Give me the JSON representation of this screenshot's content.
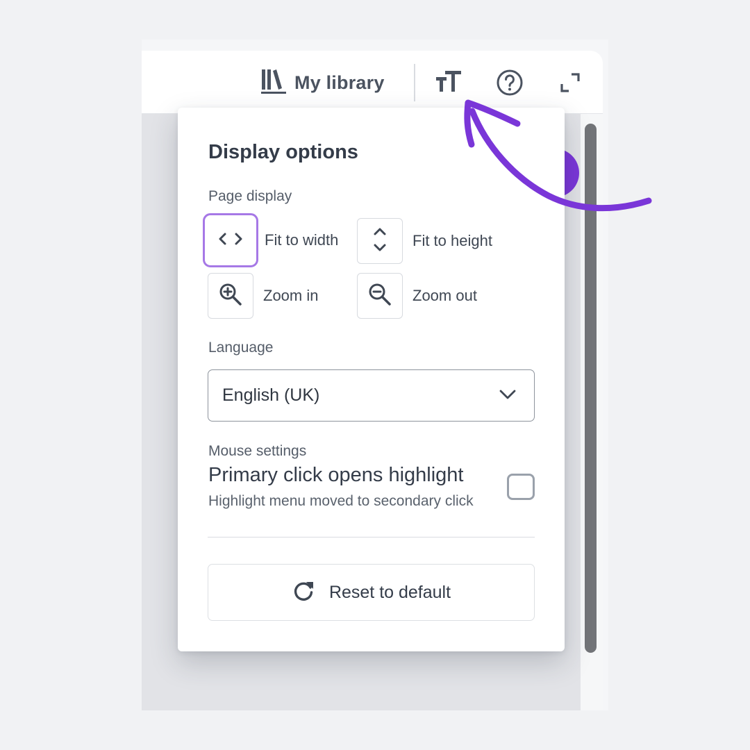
{
  "toolbar": {
    "library_label": "My library",
    "icons": {
      "library": "library-books-icon",
      "text_size": "text-size-icon",
      "help": "help-circle-icon",
      "fullscreen": "fullscreen-icon"
    }
  },
  "panel": {
    "title": "Display options",
    "page_display": {
      "label": "Page display",
      "options": [
        {
          "label": "Fit to width",
          "icon": "chevrons-horizontal-icon",
          "selected": true
        },
        {
          "label": "Fit to height",
          "icon": "chevrons-vertical-icon",
          "selected": false
        },
        {
          "label": "Zoom in",
          "icon": "zoom-in-icon",
          "selected": false
        },
        {
          "label": "Zoom out",
          "icon": "zoom-out-icon",
          "selected": false
        }
      ]
    },
    "language": {
      "label": "Language",
      "value": "English (UK)"
    },
    "mouse": {
      "label": "Mouse settings",
      "title": "Primary click opens highlight",
      "description": "Highlight menu moved to secondary click",
      "checked": false
    },
    "reset_label": "Reset to default"
  },
  "colors": {
    "accent": "#7a36d8",
    "selected_border": "#a678e6",
    "text": "#343c49"
  }
}
